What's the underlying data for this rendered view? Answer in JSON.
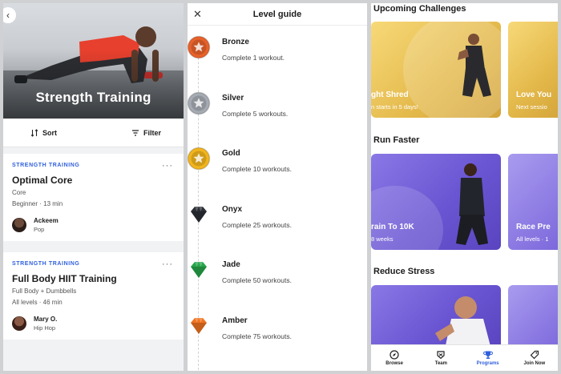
{
  "strength": {
    "hero_title": "Strength Training",
    "sort_label": "Sort",
    "filter_label": "Filter",
    "workouts": [
      {
        "category": "STRENGTH TRAINING",
        "title": "Optimal Core",
        "focus": "Core",
        "meta": "Beginner · 13 min",
        "coach": "Ackeem",
        "genre": "Pop"
      },
      {
        "category": "STRENGTH TRAINING",
        "title": "Full Body HIIT Training",
        "focus": "Full Body + Dumbbells",
        "meta": "All levels · 46 min",
        "coach": "Mary O.",
        "genre": "Hip Hop"
      }
    ]
  },
  "level_guide": {
    "title": "Level guide",
    "levels": [
      {
        "name": "Bronze",
        "desc": "Complete 1 workout.",
        "color": "#e8622a",
        "icon": "star-medal-icon"
      },
      {
        "name": "Silver",
        "desc": "Complete 5 workouts.",
        "color": "#a6abb3",
        "icon": "star-medal-icon"
      },
      {
        "name": "Gold",
        "desc": "Complete 10 workouts.",
        "color": "#f2b51e",
        "icon": "star-medal-icon"
      },
      {
        "name": "Onyx",
        "desc": "Complete 25 workouts.",
        "color": "#2b2f36",
        "icon": "gem-icon"
      },
      {
        "name": "Jade",
        "desc": "Complete 50 workouts.",
        "color": "#27a64a",
        "icon": "gem-icon"
      },
      {
        "name": "Amber",
        "desc": "Complete 75 workouts.",
        "color": "#f0731f",
        "icon": "gem-icon"
      }
    ]
  },
  "programs": {
    "sections": [
      {
        "title": "Upcoming Challenges",
        "cards": [
          {
            "title": "ght Shred",
            "subtitle": "n starts in 5 days!"
          },
          {
            "title": "Love You",
            "subtitle": "Next sessio"
          }
        ]
      },
      {
        "title": "Run Faster",
        "cards": [
          {
            "title": "rain To 10K",
            "subtitle": "8 weeks"
          },
          {
            "title": "Race Pre",
            "subtitle": "All levels · 1"
          }
        ]
      },
      {
        "title": "Reduce Stress",
        "cards": []
      }
    ],
    "tabs": [
      {
        "label": "Browse",
        "icon": "compass-icon",
        "active": false
      },
      {
        "label": "Team",
        "icon": "team-icon",
        "active": false
      },
      {
        "label": "Programs",
        "icon": "trophy-icon",
        "active": true
      },
      {
        "label": "Join Now",
        "icon": "tag-icon",
        "active": false
      }
    ],
    "accent": "#2f5fdc"
  }
}
